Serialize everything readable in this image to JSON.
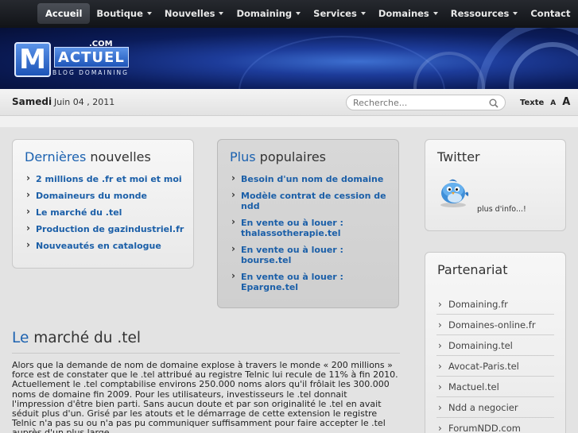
{
  "nav": {
    "items": [
      {
        "label": "Accueil",
        "active": true,
        "dropdown": false
      },
      {
        "label": "Boutique",
        "active": false,
        "dropdown": true
      },
      {
        "label": "Nouvelles",
        "active": false,
        "dropdown": true
      },
      {
        "label": "Domaining",
        "active": false,
        "dropdown": true
      },
      {
        "label": "Services",
        "active": false,
        "dropdown": true
      },
      {
        "label": "Domaines",
        "active": false,
        "dropdown": true
      },
      {
        "label": "Ressources",
        "active": false,
        "dropdown": true
      },
      {
        "label": "Contact",
        "active": false,
        "dropdown": false
      }
    ]
  },
  "logo": {
    "mark": "M",
    "word": "ACTUEL",
    "com": ".COM",
    "tagline": "BLOG DOMAINING"
  },
  "datebar": {
    "day": "Samedi",
    "date": "Juin 04 , 2011",
    "search_placeholder": "Recherche...",
    "text_label": "Texte",
    "text_small": "A",
    "text_big": "A"
  },
  "latest": {
    "title_highlight": "Dernières",
    "title_rest": " nouvelles",
    "items": [
      "2 millions de .fr et moi et moi",
      "Domaineurs du monde",
      "Le marché du .tel",
      "Production de gazindustriel.fr",
      "Nouveautés en catalogue"
    ]
  },
  "popular": {
    "title_highlight": "Plus",
    "title_rest": " populaires",
    "items": [
      "Besoin d'un nom de domaine",
      "Modèle contrat de cession de ndd",
      "En vente ou à louer : thalassotherapie.tel",
      "En vente ou à louer : bourse.tel",
      "En vente ou à louer : Epargne.tel"
    ]
  },
  "twitter": {
    "title": "Twitter",
    "more": "plus d'info...!"
  },
  "partners": {
    "title": "Partenariat",
    "items": [
      "Domaining.fr",
      "Domaines-online.fr",
      "Domaining.tel",
      "Avocat-Paris.tel",
      "Mactuel.tel",
      "Ndd a negocier",
      "ForumNDD.com"
    ]
  },
  "article": {
    "title_highlight": "Le",
    "title_rest": " marché du .tel",
    "body": "Alors que la demande de nom de domaine explose à travers le monde « 200 millions » force est de constater que le .tel attribué au registre Telnic lui recule de 11% à fin 2010. Actuellement le .tel comptabilise environs 250.000 noms alors qu'il frôlait les 300.000 noms de domaine fin 2009. Pour les utilisateurs, investisseurs  le .tel donnait l'impression d'être bien parti. Sans aucun doute et par son originalité le .tel en avait séduit  plus d'un. Grisé par les atouts et le démarrage de cette extension le registre Telnic n'a pas su ou n'a pas pu communiquer suffisamment pour faire accepter le .tel auprès d'un plus large"
  },
  "colors": {
    "accent": "#1c62b0",
    "nav_bg": "#1a1c21",
    "banner": "#0b1c5a"
  }
}
